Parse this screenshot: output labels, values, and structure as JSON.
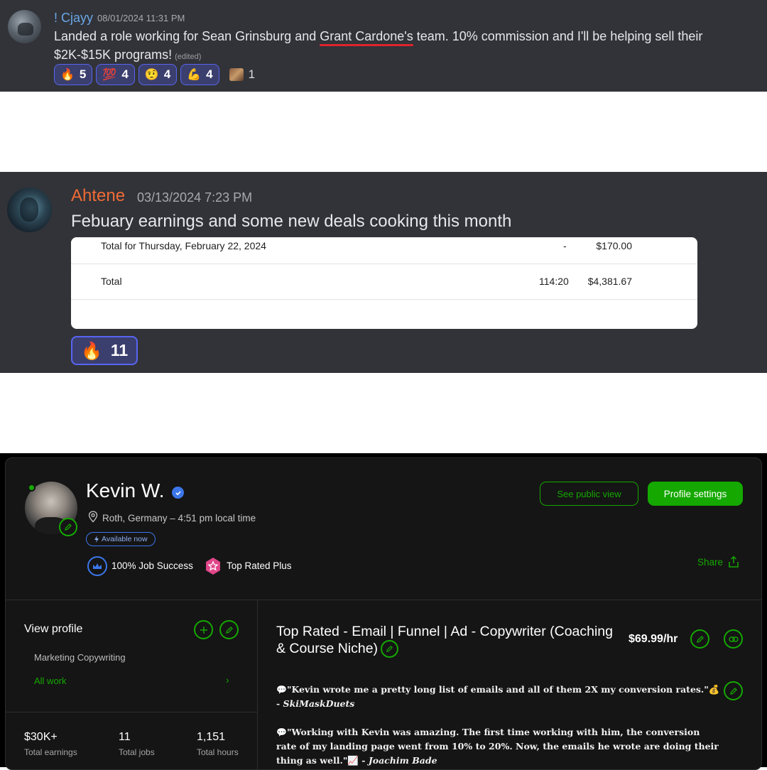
{
  "message1": {
    "username": "! Cjayy",
    "timestamp": "08/01/2024 11:31 PM",
    "text_before": "Landed a role working for Sean Grinsburg and ",
    "text_underlined": "Grant Cardone's",
    "text_after": " team. 10% commission and I'll be helping sell their $2K-$15K programs!",
    "edited_label": "(edited)",
    "reactions": [
      {
        "emoji": "🔥",
        "count": "5"
      },
      {
        "emoji": "💯",
        "count": "4"
      },
      {
        "emoji": "🤨",
        "count": "4"
      },
      {
        "emoji": "💪",
        "count": "4"
      },
      {
        "emoji": "custom-emoji",
        "count": "1"
      }
    ]
  },
  "message2": {
    "username": "Ahtene",
    "timestamp": "03/13/2024 7:23 PM",
    "text": "Febuary earnings and some new deals cooking this month",
    "earnings": {
      "row1_label": "Total for Thursday, February 22, 2024",
      "row1_hours": "-",
      "row1_amount": "$170.00",
      "row2_label": "Total",
      "row2_hours": "114:20",
      "row2_amount": "$4,381.67"
    },
    "reaction": {
      "emoji": "🔥",
      "count": "11"
    }
  },
  "profile": {
    "name": "Kevin W.",
    "location": "Roth, Germany – 4:51 pm local time",
    "availability": "Available now",
    "job_success": "100% Job Success",
    "top_rated": "Top Rated Plus",
    "public_view_label": "See public view",
    "settings_label": "Profile settings",
    "share_label": "Share",
    "sidebar": {
      "title": "View profile",
      "specialty": "Marketing Copywriting",
      "all_work": "All work"
    },
    "stats": [
      {
        "value": "$30K+",
        "label": "Total earnings"
      },
      {
        "value": "11",
        "label": "Total jobs"
      },
      {
        "value": "1,151",
        "label": "Total hours"
      }
    ],
    "job_title": "Top Rated - Email | Funnel | Ad - Copywriter (Coaching & Course Niche)",
    "rate": "$69.99/hr",
    "testimonials": [
      {
        "text": "\"Kevin wrote me a pretty long list of emails and all of them 2X my conversion rates.\"💰 - ",
        "author": "SkiMaskDuets"
      },
      {
        "text": "\"Working with Kevin was amazing. The first time working with him, the conversion rate of my landing page went from 10% to 20%. Now, the emails he wrote are doing their thing as well.\"📈 - ",
        "author": "Joachim Bade"
      }
    ]
  },
  "colors": {
    "discord_bg": "#313338",
    "discord_blurple": "#5865f2",
    "upwork_green": "#14a800",
    "verified_blue": "#3c76ea",
    "underline_red": "#e0242d"
  }
}
